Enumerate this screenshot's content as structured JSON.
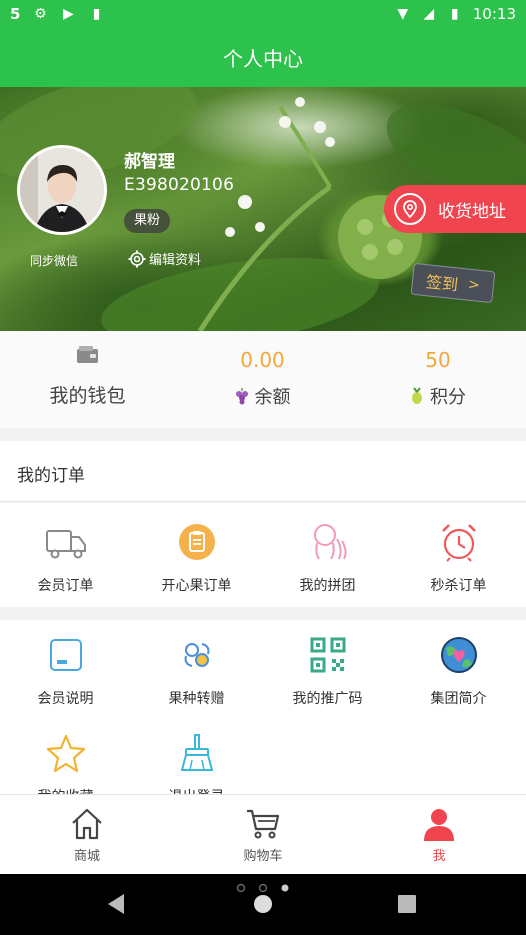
{
  "status_bar": {
    "time": "10:13",
    "left_text": "5"
  },
  "title": "个人中心",
  "profile": {
    "name": "郝智理",
    "id": "E398020106",
    "badge": "果粉",
    "sync_label": "同步微信",
    "edit_label": "编辑资料"
  },
  "address_button": {
    "label": "收货地址"
  },
  "checkin_button": {
    "label": "签到"
  },
  "wallet": {
    "label": "我的钱包",
    "balance_value": "0.00",
    "balance_label": "余额",
    "points_value": "50",
    "points_label": "积分"
  },
  "orders": {
    "title": "我的订单",
    "items": [
      {
        "label": "会员订单",
        "icon": "truck-icon"
      },
      {
        "label": "开心果订单",
        "icon": "clipboard-icon"
      },
      {
        "label": "我的拼团",
        "icon": "group-icon"
      },
      {
        "label": "秒杀订单",
        "icon": "alarm-clock-icon"
      }
    ]
  },
  "services": {
    "items": [
      {
        "label": "会员说明",
        "icon": "card-icon"
      },
      {
        "label": "果种转赠",
        "icon": "transfer-icon"
      },
      {
        "label": "我的推广码",
        "icon": "qr-code-icon"
      },
      {
        "label": "集团简介",
        "icon": "globe-icon"
      },
      {
        "label": "我的收藏",
        "icon": "star-icon"
      },
      {
        "label": "退出登录",
        "icon": "broom-icon"
      }
    ]
  },
  "bottom_nav": {
    "items": [
      {
        "label": "商城",
        "icon": "home-icon"
      },
      {
        "label": "购物车",
        "icon": "cart-icon"
      },
      {
        "label": "我",
        "icon": "person-icon"
      }
    ]
  },
  "colors": {
    "brand_green": "#2dc24b",
    "accent_red": "#f0454f",
    "value_orange": "#f3a83a"
  }
}
